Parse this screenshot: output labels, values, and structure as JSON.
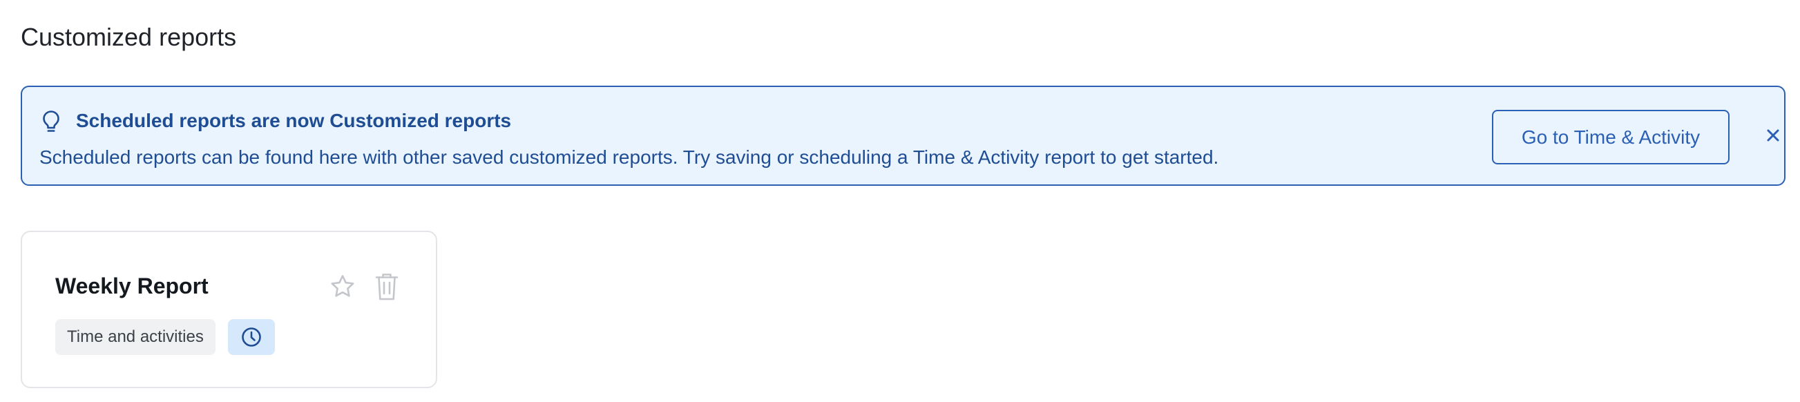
{
  "page": {
    "title": "Customized reports"
  },
  "banner": {
    "icon": "lightbulb-icon",
    "title": "Scheduled reports are now Customized reports",
    "text": "Scheduled reports can be found here with other saved customized reports. Try saving or scheduling a Time & Activity report to get started.",
    "button_label": "Go to Time & Activity",
    "close_icon": "close-icon",
    "colors": {
      "background": "#eaf4fe",
      "border": "#2b5fb4",
      "text": "#1f4d94"
    }
  },
  "reports": [
    {
      "title": "Weekly Report",
      "tag": "Time and activities",
      "icons": [
        "star-icon",
        "trash-icon",
        "clock-icon"
      ],
      "favorite": false,
      "scheduled": true
    }
  ]
}
